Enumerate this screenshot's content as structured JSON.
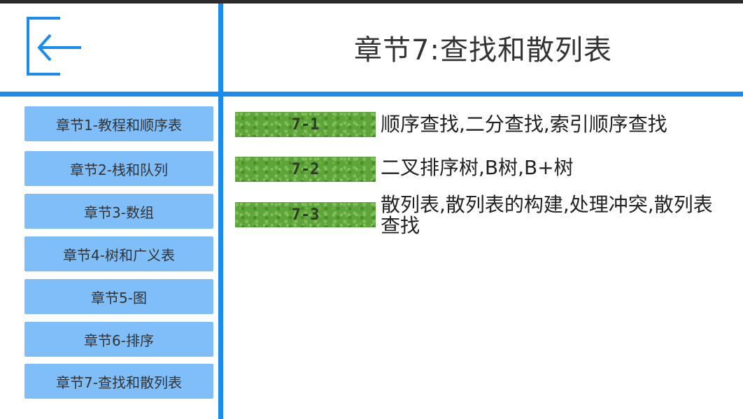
{
  "header": {
    "back_icon": "exit-arrow-icon",
    "title": "章节7:查找和散列表"
  },
  "sidebar": {
    "items": [
      {
        "label": "章节1-教程和顺序表"
      },
      {
        "label": "章节2-栈和队列"
      },
      {
        "label": "章节3-数组"
      },
      {
        "label": "章节4-树和广义表"
      },
      {
        "label": "章节5-图"
      },
      {
        "label": "章节6-排序"
      },
      {
        "label": "章节7-查找和散列表"
      }
    ]
  },
  "sections": [
    {
      "tag": "7-1",
      "description": "顺序查找,二分查找,索引顺序查找"
    },
    {
      "tag": "7-2",
      "description": "二叉排序树,B树,B+树"
    },
    {
      "tag": "7-3",
      "description": "散列表,散列表的构建,处理冲突,散列表查找"
    }
  ],
  "colors": {
    "accent": "#1a8cf0",
    "sidebar_button": "#7fbef8",
    "tag_green": "#5ea43a"
  }
}
